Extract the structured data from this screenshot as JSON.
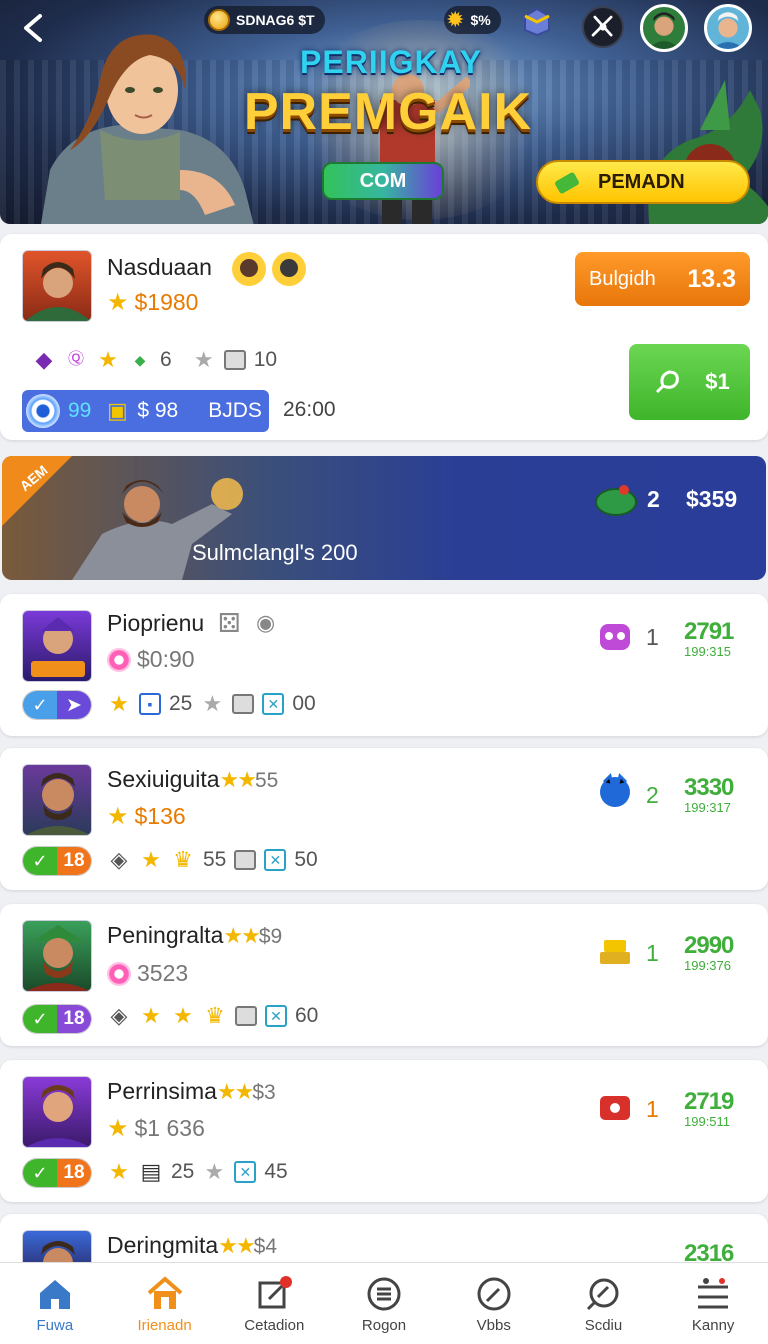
{
  "header": {
    "coins": "SDNAG6 $T",
    "gems": "$%",
    "subtitle": "PERIIGKAY",
    "title": "PREMGAIK",
    "com_button": "COM",
    "premadn_button": "PEMADN"
  },
  "featured": {
    "name": "Nasduaan",
    "money": "$1980",
    "stat1": "6",
    "stat2": "10",
    "bar_value1": "99",
    "bar_value2": "$ 98",
    "bar_label": "BJDS",
    "time": "26:00",
    "bulgidh_label": "Bulgidh",
    "bulgidh_value": "13.3",
    "green_value": "$1"
  },
  "banner": {
    "ribbon": "AEM",
    "title": "Sulmclangl's 200",
    "count": "2",
    "price": "$359"
  },
  "rows": [
    {
      "name": "Pioprienu",
      "extra": "",
      "money": "$0:90",
      "badge": "",
      "stat1": "25",
      "stat2": "00",
      "count": "1",
      "score": "2791",
      "time": "199:315"
    },
    {
      "name": "Sexiuiguita",
      "extra": "55",
      "money": "$136",
      "badge": "18",
      "stat1": "55",
      "stat2": "50",
      "count": "2",
      "score": "3330",
      "time": "199:317"
    },
    {
      "name": "Peningralta",
      "extra": "$9",
      "money": "3523",
      "badge": "18",
      "stat1": "",
      "stat2": "60",
      "count": "1",
      "score": "2990",
      "time": "199:376"
    },
    {
      "name": "Perrinsima",
      "extra": "$3",
      "money": "$1 636",
      "badge": "18",
      "stat1": "25",
      "stat2": "45",
      "count": "1",
      "score": "2719",
      "time": "199:511"
    },
    {
      "name": "Deringmita",
      "extra": "$4",
      "score": "2316"
    }
  ],
  "nav": [
    "Fuwa",
    "Irienadn",
    "Cetadion",
    "Rogon",
    "Vbbs",
    "Scdiu",
    "Kanny"
  ],
  "colors": {
    "accent": "#f0901a",
    "green": "#3fae3a",
    "blue": "#2a3d9a"
  }
}
